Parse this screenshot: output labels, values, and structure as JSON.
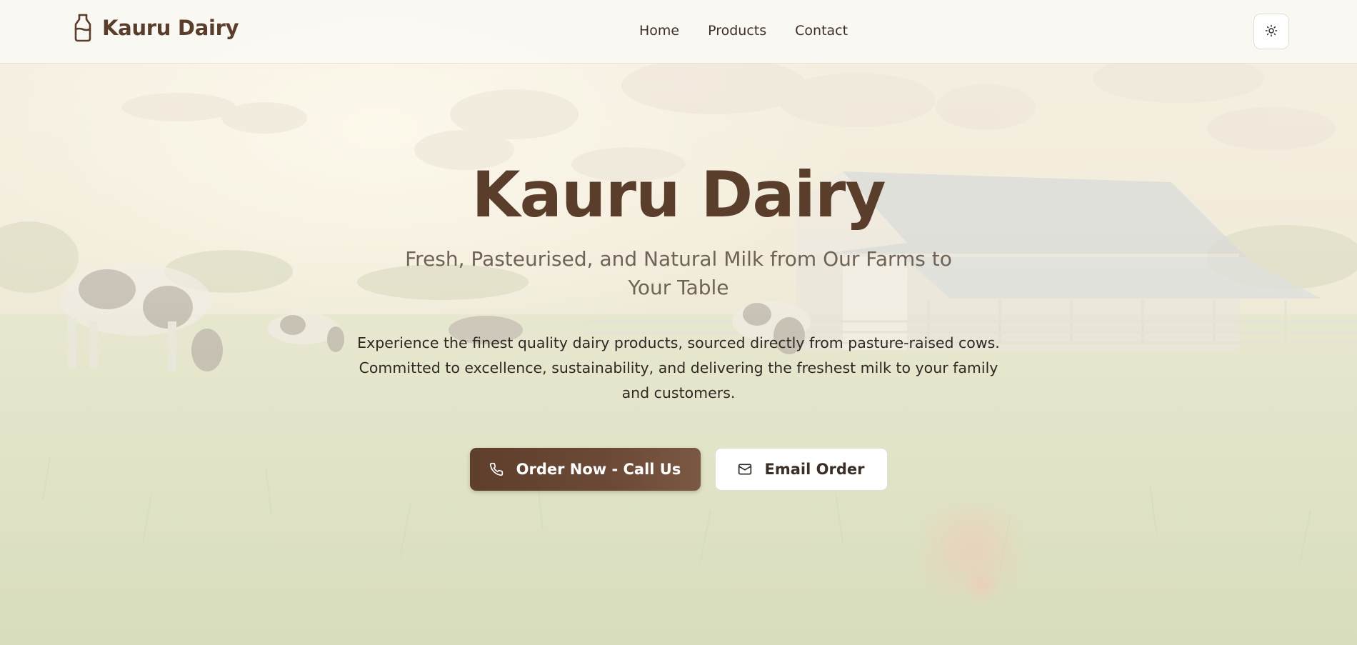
{
  "header": {
    "brand_name": "Kauru Dairy",
    "brand_icon": "milk-bottle-icon",
    "nav": [
      {
        "label": "Home"
      },
      {
        "label": "Products"
      },
      {
        "label": "Contact"
      }
    ],
    "theme_toggle_icon": "sun-icon"
  },
  "hero": {
    "title": "Kauru Dairy",
    "subtitle": "Fresh, Pasteurised, and Natural Milk from Our Farms to Your Table",
    "description": "Experience the finest quality dairy products, sourced directly from pasture-raised cows. Committed to excellence, sustainability, and delivering the freshest milk to your family and customers.",
    "primary_button": {
      "label": "Order Now - Call Us",
      "icon": "phone-icon"
    },
    "secondary_button": {
      "label": "Email Order",
      "icon": "mail-icon"
    },
    "background_image": "farm-pasture-with-cows-and-barn"
  },
  "colors": {
    "brand_brown": "#5a3d2b",
    "primary_button_start": "#5e3f2c",
    "primary_button_end": "#7a5843",
    "header_bg": "#faf8f4"
  }
}
